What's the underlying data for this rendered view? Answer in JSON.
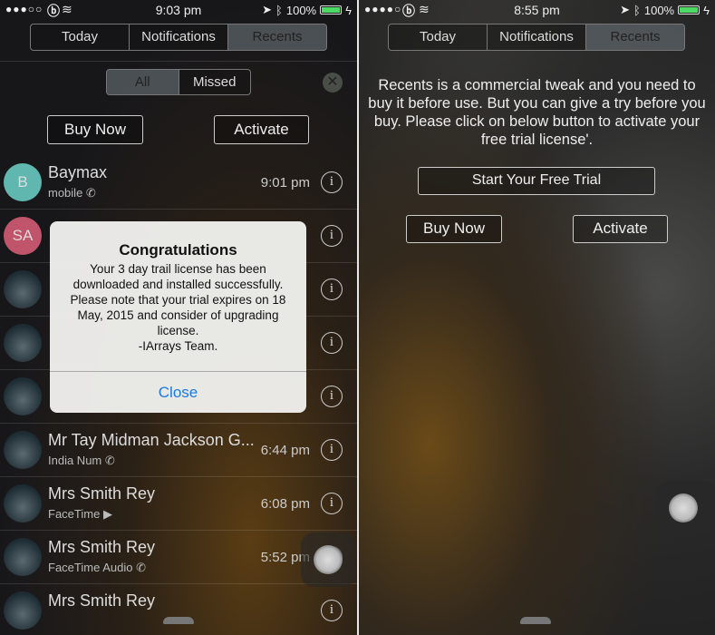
{
  "left": {
    "status": {
      "signal": "●●●○○",
      "time": "9:03 pm",
      "battery": "100%"
    },
    "tabs": [
      {
        "label": "Today"
      },
      {
        "label": "Notifications"
      },
      {
        "label": "Recents",
        "active": true
      }
    ],
    "filter": [
      {
        "label": "All",
        "active": true
      },
      {
        "label": "Missed"
      }
    ],
    "buy_now": "Buy Now",
    "activate": "Activate",
    "calls": [
      {
        "initials": "B",
        "name": "Baymax",
        "type": "mobile",
        "type_icon": "phone-outgoing-icon",
        "time": "9:01 pm",
        "avatar_color": "#5fb7b0"
      },
      {
        "initials": "SA",
        "name": "",
        "type": "",
        "time": "",
        "avatar_color": "#c0546a"
      },
      {
        "initials": "",
        "name": "",
        "type": "",
        "time": ""
      },
      {
        "initials": "",
        "name": "",
        "type": "",
        "time": ""
      },
      {
        "initials": "",
        "name": "",
        "type": "",
        "time": ""
      },
      {
        "initials": "",
        "name": "Mr Tay Midman Jackson G...",
        "type": "India Num",
        "type_icon": "phone-outgoing-icon",
        "time": "6:44 pm"
      },
      {
        "initials": "",
        "name": "Mrs Smith Rey",
        "type": "FaceTime",
        "type_icon": "video-camera-icon",
        "time": "6:08 pm"
      },
      {
        "initials": "",
        "name": "Mrs Smith Rey",
        "type": "FaceTime Audio",
        "type_icon": "phone-outgoing-icon",
        "time": "5:52 pm"
      },
      {
        "initials": "",
        "name": "Mrs Smith Rey",
        "type": "",
        "time": ""
      }
    ],
    "dialog": {
      "title": "Congratulations",
      "message": "Your 3 day trail license has been downloaded and installed successfully. Please note that your trial expires on 18 May, 2015 and consider of upgrading license.",
      "signature": "-IArrays Team.",
      "close": "Close"
    }
  },
  "right": {
    "status": {
      "signal": "●●●●○",
      "time": "8:55 pm",
      "battery": "100%"
    },
    "tabs": [
      {
        "label": "Today"
      },
      {
        "label": "Notifications"
      },
      {
        "label": "Recents",
        "active": true
      }
    ],
    "message": "Recents is a commercial tweak and you need to buy it before use. But you can give a try before you buy. Please click on below button to activate your free trial license'.",
    "trial": "Start Your Free Trial",
    "buy_now": "Buy Now",
    "activate": "Activate"
  },
  "colors": {
    "link": "#1a7ae0",
    "battery": "#4cd964"
  }
}
